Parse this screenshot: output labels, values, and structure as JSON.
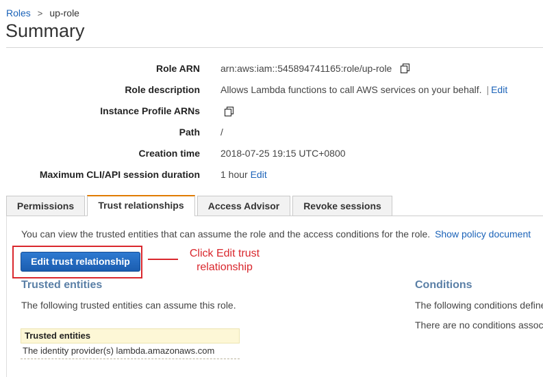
{
  "breadcrumb": {
    "parent": "Roles",
    "separator": ">",
    "current": "up-role"
  },
  "page": {
    "title": "Summary"
  },
  "summary": {
    "role_arn": {
      "label": "Role ARN",
      "value": "arn:aws:iam::545894741165:role/up-role"
    },
    "role_description": {
      "label": "Role description",
      "value": "Allows Lambda functions to call AWS services on your behalf.",
      "separator": "|",
      "edit": "Edit"
    },
    "instance_profile": {
      "label": "Instance Profile ARNs"
    },
    "path": {
      "label": "Path",
      "value": "/"
    },
    "creation_time": {
      "label": "Creation time",
      "value": "2018-07-25 19:15 UTC+0800"
    },
    "max_session": {
      "label": "Maximum CLI/API session duration",
      "value": "1 hour",
      "edit": "Edit"
    }
  },
  "tabs": [
    {
      "label": "Permissions",
      "active": false
    },
    {
      "label": "Trust relationships",
      "active": true
    },
    {
      "label": "Access Advisor",
      "active": false
    },
    {
      "label": "Revoke sessions",
      "active": false
    }
  ],
  "trust": {
    "intro": "You can view the trusted entities that can assume the role and the access conditions for the role.",
    "show_policy": "Show policy document",
    "edit_button": "Edit trust relationship",
    "annotation_line1": "Click Edit trust",
    "annotation_line2": "relationship",
    "trusted_heading": "Trusted entities",
    "trusted_desc": "The following trusted entities can assume this role.",
    "table_header": "Trusted entities",
    "table_rows": [
      "The identity provider(s) lambda.amazonaws.com"
    ],
    "conditions_heading": "Conditions",
    "conditions_desc": "The following conditions define",
    "conditions_none": "There are no conditions assoc"
  },
  "colors": {
    "link": "#1a62b8",
    "active_tab_accent": "#e07b00",
    "annotation": "#d9262c",
    "section_heading": "#5a7fa6"
  },
  "icons": {
    "copy": "copy-icon"
  }
}
